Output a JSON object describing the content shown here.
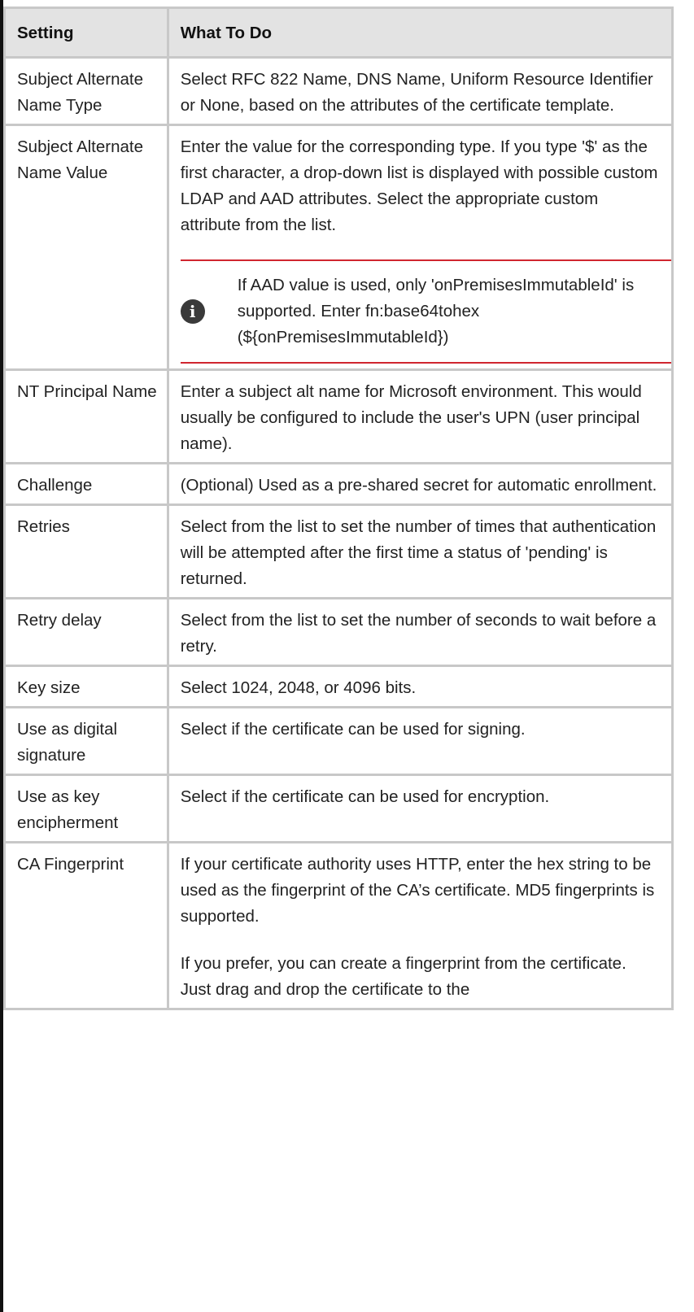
{
  "table": {
    "headers": {
      "setting": "Setting",
      "what": "What To Do"
    },
    "rows": [
      {
        "setting": "Subject Alternate Name Type",
        "what": [
          "Select RFC 822 Name, DNS Name, Uniform Resource Identifier or None, based on the attributes of the certificate template."
        ]
      },
      {
        "setting": "Subject Alternate Name Value",
        "what": [
          "Enter the value for the corresponding type. If you type '$' as the first character, a drop-down list is displayed with possible custom LDAP and AAD attributes. Select the appropriate custom attribute from the list."
        ],
        "note": {
          "icon": "info-icon",
          "text": "If AAD value is used, only 'onPremisesImmutableId' is supported. Enter fn:base64tohex (${onPremisesImmutableId})"
        }
      },
      {
        "setting": "NT Principal Name",
        "what": [
          "Enter a subject alt name for Microsoft environment. This would usually be configured to include the user's UPN (user principal name)."
        ]
      },
      {
        "setting": "Challenge",
        "what": [
          "(Optional) Used as a pre-shared secret for automatic enrollment."
        ]
      },
      {
        "setting": "Retries",
        "what": [
          "Select from the list to set the number of times that authentication will be attempted after the first time a status of 'pending' is returned."
        ]
      },
      {
        "setting": "Retry delay",
        "what": [
          "Select from the list to set the number of seconds to wait before a retry."
        ]
      },
      {
        "setting": "Key size",
        "what": [
          "Select 1024, 2048, or 4096 bits."
        ]
      },
      {
        "setting": "Use as digital signature",
        "what": [
          "Select if the certificate can be used for signing."
        ]
      },
      {
        "setting": "Use as key encipherment",
        "what": [
          "Select if the certificate can be used for encryption."
        ]
      },
      {
        "setting": "CA Fingerprint",
        "what": [
          "If your certificate authority uses HTTP, enter the hex string to be used as the fingerprint of the CA’s certificate. MD5 fingerprints is supported.",
          "If you prefer, you can create a fingerprint from the certificate. Just drag and drop the certificate to the"
        ]
      }
    ]
  },
  "colors": {
    "header_bg": "#e3e3e3",
    "border": "#c8c8c8",
    "note_rule": "#d0262f",
    "icon_bg": "#3a3a3a"
  }
}
